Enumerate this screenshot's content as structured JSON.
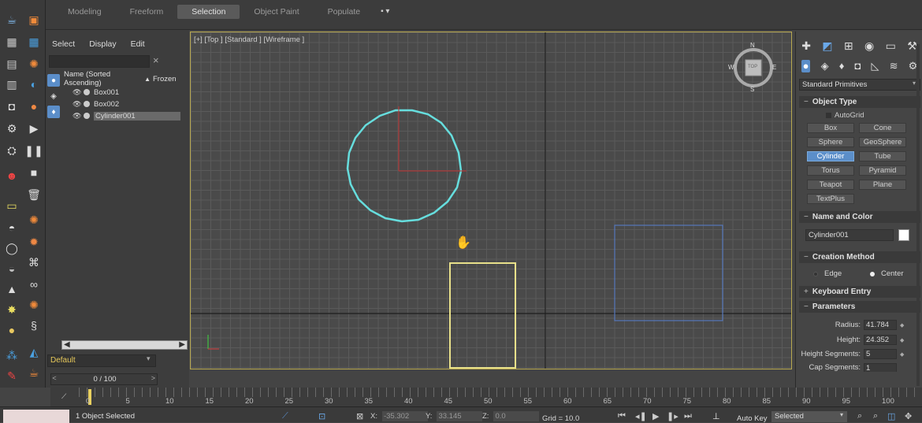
{
  "ribbon": {
    "tabs": [
      "Modeling",
      "Freeform",
      "Selection",
      "Object Paint",
      "Populate"
    ],
    "active_tab": "Selection"
  },
  "scene_explorer": {
    "menu": [
      "Select",
      "Display",
      "Edit"
    ],
    "search_placeholder": "",
    "clear_icon": "×",
    "header": {
      "name_col": "Name (Sorted Ascending)",
      "sort_arrow": "▲",
      "frozen_col": "Frozen"
    },
    "rows": [
      {
        "label": "Box001",
        "selected": false
      },
      {
        "label": "Box002",
        "selected": false
      },
      {
        "label": "Cylinder001",
        "selected": true
      }
    ],
    "layer": "Default"
  },
  "viewport": {
    "label": "[+] [Top ] [Standard ] [Wireframe ]",
    "viewcube": {
      "top": "TOP",
      "n": "N",
      "s": "S",
      "e": "E",
      "w": "W"
    }
  },
  "command_panel": {
    "category": "Standard Primitives",
    "object_type": {
      "title": "Object Type",
      "autogrid": "AutoGrid",
      "buttons": [
        "Box",
        "Cone",
        "Sphere",
        "GeoSphere",
        "Cylinder",
        "Tube",
        "Torus",
        "Pyramid",
        "Teapot",
        "Plane",
        "TextPlus"
      ],
      "active": "Cylinder"
    },
    "name_color": {
      "title": "Name and Color",
      "name": "Cylinder001",
      "color": "#ffffff"
    },
    "creation_method": {
      "title": "Creation Method",
      "options": [
        "Edge",
        "Center"
      ],
      "selected": "Center"
    },
    "keyboard_entry": {
      "title": "Keyboard Entry"
    },
    "parameters": {
      "title": "Parameters",
      "fields": [
        {
          "label": "Radius:",
          "value": "41.784"
        },
        {
          "label": "Height:",
          "value": "24.352"
        },
        {
          "label": "Height Segments:",
          "value": "5"
        },
        {
          "label": "Cap Segments:",
          "value": "1"
        }
      ]
    }
  },
  "timeline": {
    "slider_label": "0 / 100",
    "ticks": [
      "0",
      "5",
      "10",
      "15",
      "20",
      "25",
      "30",
      "35",
      "40",
      "45",
      "50",
      "55",
      "60",
      "65",
      "70",
      "75",
      "80",
      "85",
      "90",
      "95",
      "100"
    ]
  },
  "status_bar": {
    "status_text": "1 Object Selected",
    "x_label": "X:",
    "x_value": "-35.302",
    "y_label": "Y:",
    "y_value": "33.145",
    "z_label": "Z:",
    "z_value": "0.0",
    "grid": "Grid = 10.0",
    "auto_key": "Auto Key",
    "selected_dropdown": "Selected"
  },
  "colors": {
    "cylinder": "#66dddd",
    "box_yellow": "#e8e08a",
    "box_blue": "#5577bb",
    "active_button": "#5b8ec9",
    "viewport_border": "#b8a850"
  }
}
